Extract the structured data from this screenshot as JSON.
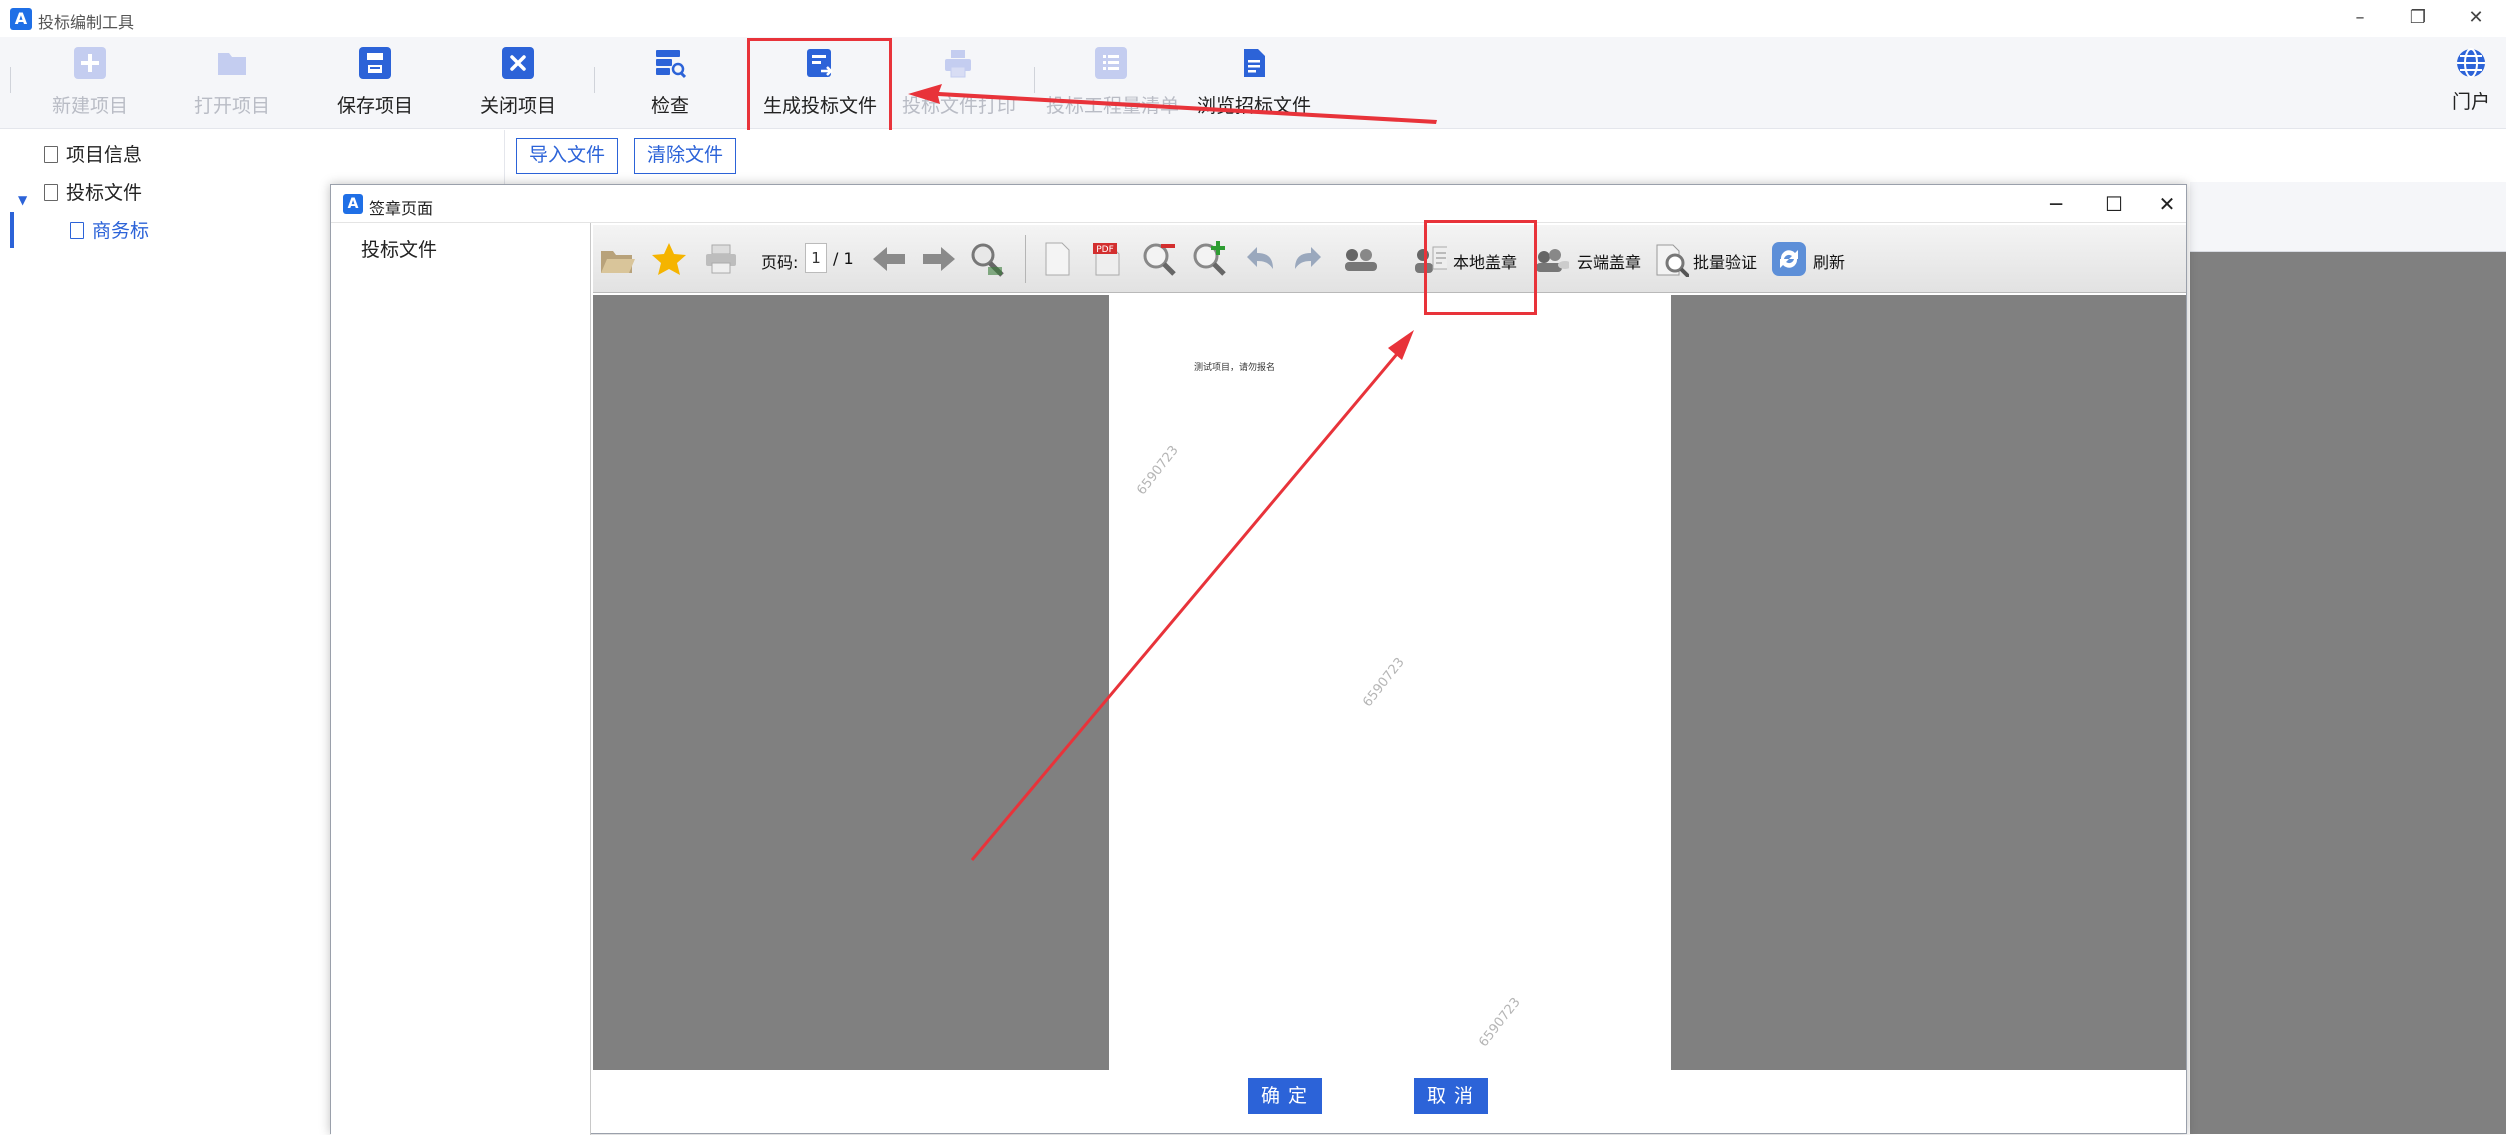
{
  "window": {
    "logo_text": "A",
    "title": "投标编制工具",
    "minimize_glyph": "–",
    "restore_glyph": "❐",
    "close_glyph": "✕"
  },
  "toolbar": {
    "buttons": [
      {
        "id": "new-project",
        "label": "新建项目",
        "icon": "plus-icon",
        "enabled": false
      },
      {
        "id": "open-project",
        "label": "打开项目",
        "icon": "folder-icon",
        "enabled": false
      },
      {
        "id": "save-project",
        "label": "保存项目",
        "icon": "save-icon",
        "enabled": true
      },
      {
        "id": "close-project",
        "label": "关闭项目",
        "icon": "close-icon",
        "enabled": true
      },
      {
        "id": "check",
        "label": "检查",
        "icon": "inspect-icon",
        "enabled": true
      },
      {
        "id": "generate-bid",
        "label": "生成投标文件",
        "icon": "generate-doc-icon",
        "enabled": true
      },
      {
        "id": "print-bid",
        "label": "投标文件打印",
        "icon": "printer-icon",
        "enabled": false
      },
      {
        "id": "list",
        "label": "投标工程量清单",
        "icon": "list-icon",
        "enabled": false
      },
      {
        "id": "browse-tender",
        "label": "浏览招标文件",
        "icon": "document-icon",
        "enabled": true
      },
      {
        "id": "portal",
        "label": "门户",
        "icon": "globe-icon",
        "enabled": true
      }
    ]
  },
  "tree": {
    "items": [
      {
        "label": "项目信息"
      },
      {
        "label": "投标文件"
      },
      {
        "label": "商务标"
      }
    ]
  },
  "content": {
    "import_label": "导入文件",
    "clear_label": "清除文件"
  },
  "dialog": {
    "logo_text": "A",
    "title": "签章页面",
    "minimize_glyph": "─",
    "maximize_glyph": "☐",
    "close_glyph": "✕",
    "left_item": "投标文件",
    "viewer": {
      "page_label": "页码:",
      "page_current": "1",
      "page_total": "/ 1",
      "local_seal_label": "本地盖章",
      "cloud_seal_label": "云端盖章",
      "batch_verify_label": "批量验证",
      "refresh_label": "刷新",
      "pdf_badge": "PDF"
    },
    "document": {
      "text": "测试项目，请勿报名",
      "watermark": "6590723"
    },
    "confirm_label": "确定",
    "cancel_label": "取消"
  },
  "colors": {
    "accent": "#2c63d8",
    "highlight": "#e8333a",
    "viewer_bg": "#808080"
  }
}
